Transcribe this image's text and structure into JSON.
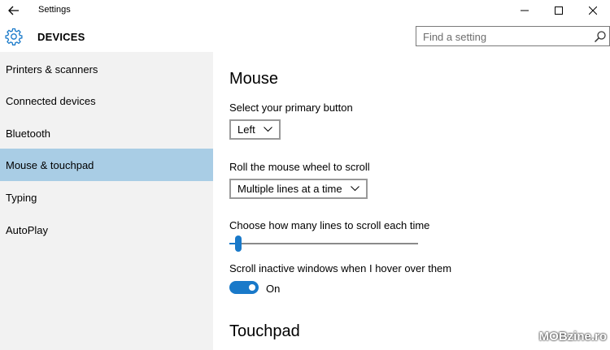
{
  "window": {
    "title": "Settings",
    "back_icon": "arrow-left-icon",
    "controls": [
      "minimize-icon",
      "maximize-icon",
      "close-icon"
    ]
  },
  "header": {
    "icon": "gear-icon",
    "title": "DEVICES",
    "search_placeholder": "Find a setting",
    "search_icon": "magnifier-icon"
  },
  "sidebar": {
    "items": [
      {
        "label": "Printers & scanners"
      },
      {
        "label": "Connected devices"
      },
      {
        "label": "Bluetooth"
      },
      {
        "label": "Mouse & touchpad",
        "active": true
      },
      {
        "label": "Typing"
      },
      {
        "label": "AutoPlay"
      }
    ],
    "active_color": "#a9cde5"
  },
  "main": {
    "mouse_heading": "Mouse",
    "primary_button_label": "Select your primary button",
    "primary_button_value": "Left",
    "scroll_label": "Roll the mouse wheel to scroll",
    "scroll_value": "Multiple lines at a time",
    "lines_label": "Choose how many lines to scroll each time",
    "lines_slider_fraction": 0.03,
    "inactive_scroll_label": "Scroll inactive windows when I hover over them",
    "inactive_scroll_state": "On",
    "touchpad_heading": "Touchpad"
  },
  "accent_color": "#1979c9",
  "watermark": "MOBzine.ro"
}
